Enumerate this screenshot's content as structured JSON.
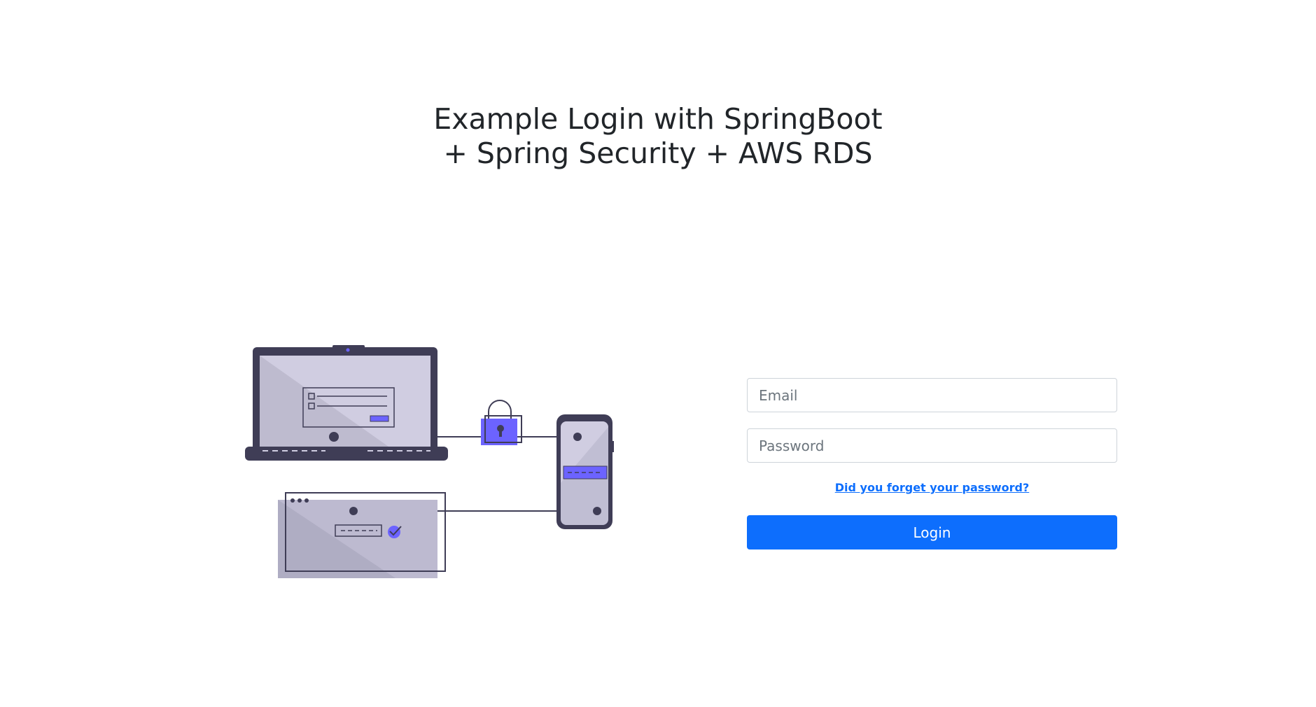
{
  "header": {
    "title_line1": "Example Login with SpringBoot",
    "title_line2": "+ Spring Security + AWS RDS"
  },
  "illustration": {
    "icon": "secure-login-devices-illustration",
    "accent_color": "#6c63ff",
    "dark_color": "#3f3d56",
    "light_color": "#d0cde1"
  },
  "form": {
    "email": {
      "placeholder": "Email",
      "value": ""
    },
    "password": {
      "placeholder": "Password",
      "value": ""
    },
    "forgot_link": "Did you forget your password?",
    "login_label": "Login",
    "button_color": "#0d6efd"
  }
}
